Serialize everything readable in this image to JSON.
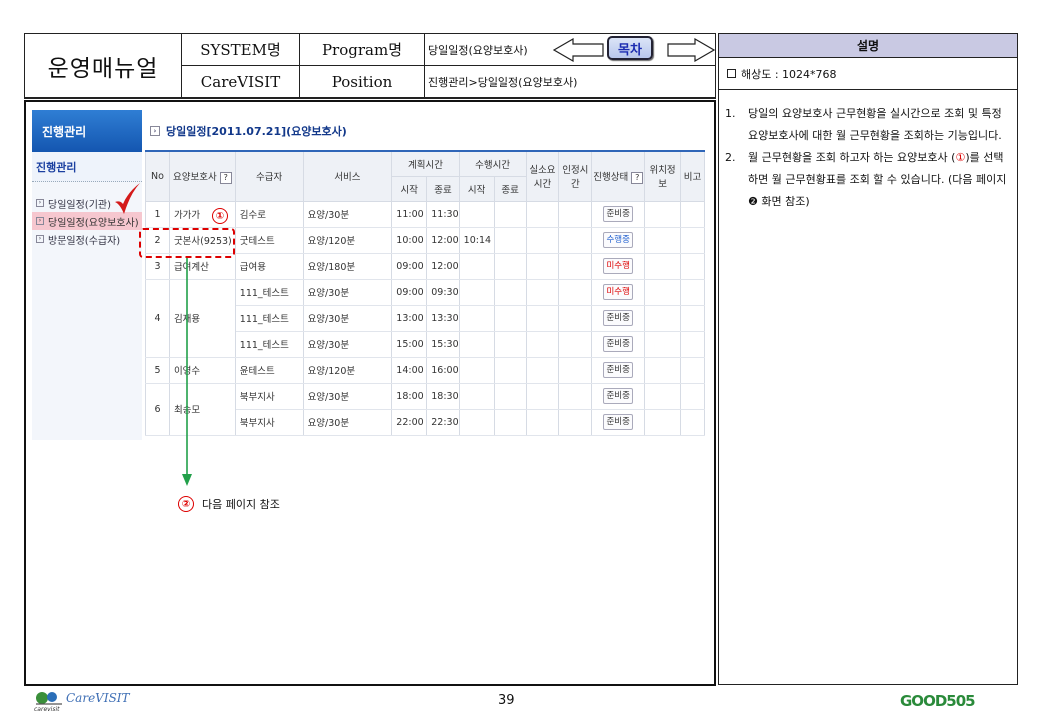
{
  "header": {
    "title": "운영매뉴얼",
    "system_label": "SYSTEM명",
    "system_value": "CareVISIT",
    "program_label": "Program명",
    "position_label": "Position",
    "program_name": "당일일정(요양보호사)",
    "position_value": "진행관리>당일일정(요양보호사)",
    "toc_label": "목차"
  },
  "desc": {
    "heading": "설명",
    "resolution": "해상도 : 1024*768",
    "items": [
      {
        "num": "1.",
        "text": "당일의 요양보호사 근무현황을 실시간으로 조회 및 특정 요양보호사에 대한 월 근무현황을 조회하는 기능입니다."
      },
      {
        "num": "2.",
        "pre": "월 근무현황을 조회 하고자 하는 요양보호사 (",
        "marker": "①",
        "post": ")를 선택하면 월 근무현황표를 조회 할 수 있습니다. (다음 페이지 ❷ 화면 참조)"
      }
    ]
  },
  "sidebar": {
    "heading": "진행관리",
    "subheading": "진행관리",
    "items": [
      "당일일정(기관)",
      "당일일정(요양보호사)",
      "방문일정(수급자)"
    ]
  },
  "content": {
    "title": "당일일정[2011.07.21](요양보호사)",
    "columns": {
      "no": "No",
      "caregiver": "요양보호사",
      "recipient": "수급자",
      "service": "서비스",
      "plan": "계획시간",
      "actual": "수행시간",
      "start": "시작",
      "end": "종료",
      "actual_time": "실소요시간",
      "approved_time": "인정시간",
      "status": "진행상태",
      "location": "위치정보",
      "note": "비고",
      "q": "?"
    },
    "rows": [
      {
        "no": "1",
        "caregiver": "가가가",
        "recipient": "김수로",
        "service": "요양/30분",
        "pstart": "11:00",
        "pend": "11:30",
        "astart": "",
        "status": "준비중",
        "status_color": "normal"
      },
      {
        "no": "2",
        "caregiver": "굿본사(9253)",
        "recipient": "굿테스트",
        "service": "요양/120분",
        "pstart": "10:00",
        "pend": "12:00",
        "astart": "10:14",
        "status": "수행중",
        "status_color": "blue"
      },
      {
        "no": "3",
        "caregiver": "급여계산",
        "recipient": "급여용",
        "service": "요양/180분",
        "pstart": "09:00",
        "pend": "12:00",
        "astart": "",
        "status": "미수행",
        "status_color": "red"
      },
      {
        "no": "4",
        "caregiver": "김재용",
        "recipient": "111_테스트",
        "service": "요양/30분",
        "pstart": "09:00",
        "pend": "09:30",
        "astart": "",
        "status": "미수행",
        "status_color": "red"
      },
      {
        "no": "",
        "caregiver": "",
        "recipient": "111_테스트",
        "service": "요양/30분",
        "pstart": "13:00",
        "pend": "13:30",
        "astart": "",
        "status": "준비중",
        "status_color": "normal"
      },
      {
        "no": "",
        "caregiver": "",
        "recipient": "111_테스트",
        "service": "요양/30분",
        "pstart": "15:00",
        "pend": "15:30",
        "astart": "",
        "status": "준비중",
        "status_color": "normal"
      },
      {
        "no": "5",
        "caregiver": "이영수",
        "recipient": "윤테스트",
        "service": "요양/120분",
        "pstart": "14:00",
        "pend": "16:00",
        "astart": "",
        "status": "준비중",
        "status_color": "normal"
      },
      {
        "no": "6",
        "caregiver": "최승모",
        "recipient": "북부지사",
        "service": "요양/30분",
        "pstart": "18:00",
        "pend": "18:30",
        "astart": "",
        "status": "준비중",
        "status_color": "normal"
      },
      {
        "no": "",
        "caregiver": "",
        "recipient": "북부지사",
        "service": "요양/30분",
        "pstart": "22:00",
        "pend": "22:30",
        "astart": "",
        "status": "준비중",
        "status_color": "normal"
      }
    ]
  },
  "annotations": {
    "marker1": "①",
    "marker2": "②",
    "next_page": "다음 페이지 참조"
  },
  "footer": {
    "page": "39",
    "logo_left": "CareVISIT",
    "logo_left_small": "carevisit",
    "logo_right": "GOOD505"
  }
}
